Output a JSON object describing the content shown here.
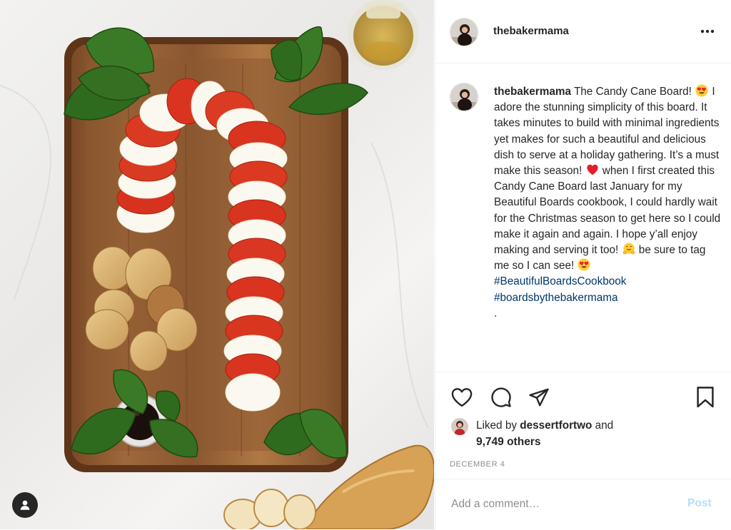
{
  "post": {
    "username": "thebakermama",
    "more_icon": "more-horizontal-icon",
    "photo_alt": "The Candy Cane Board: alternating tomato and mozzarella slices shaped like a candy cane on a wooden board with basil, crostini, bread and balsamic",
    "caption": {
      "username": "thebakermama",
      "segment_1": " The Candy Cane Board! ",
      "emoji_1": "heart-eyes-emoji",
      "segment_2": " I adore the stunning simplicity of this board. It takes minutes to build with minimal ingredients yet makes for such a beautiful and delicious dish to serve at a holiday gathering. It’s a must make this season! ",
      "emoji_2": "red-heart-emoji",
      "segment_3": " when I first created this Candy Cane Board last January for my Beautiful Boards cookbook, I could hardly wait for the Christmas season to get here so I could make it again and again. I hope y’all enjoy making and serving it too! ",
      "emoji_3": "hugging-face-emoji",
      "segment_4": " be sure to tag me so I can see! ",
      "emoji_4": "heart-eyes-emoji",
      "hashtag_1": "#BeautifulBoardsCookbook",
      "hashtag_2": "#boardsbythebakermama",
      "trailing": "."
    },
    "actions": {
      "like_icon": "heart-outline-icon",
      "comment_icon": "comment-icon",
      "share_icon": "paper-plane-icon",
      "save_icon": "bookmark-icon"
    },
    "likes": {
      "prefix": "Liked by",
      "liker": "dessertfortwo",
      "suffix": "and",
      "others": "9,749 others"
    },
    "date": "DECEMBER 4",
    "comment": {
      "placeholder": "Add a comment…",
      "post_label": "Post"
    }
  },
  "colors": {
    "text": "#262626",
    "secondary": "#8e8e8e",
    "hashtag": "#00376b",
    "post_disabled": "#b2dffc",
    "border": "#efefef"
  }
}
